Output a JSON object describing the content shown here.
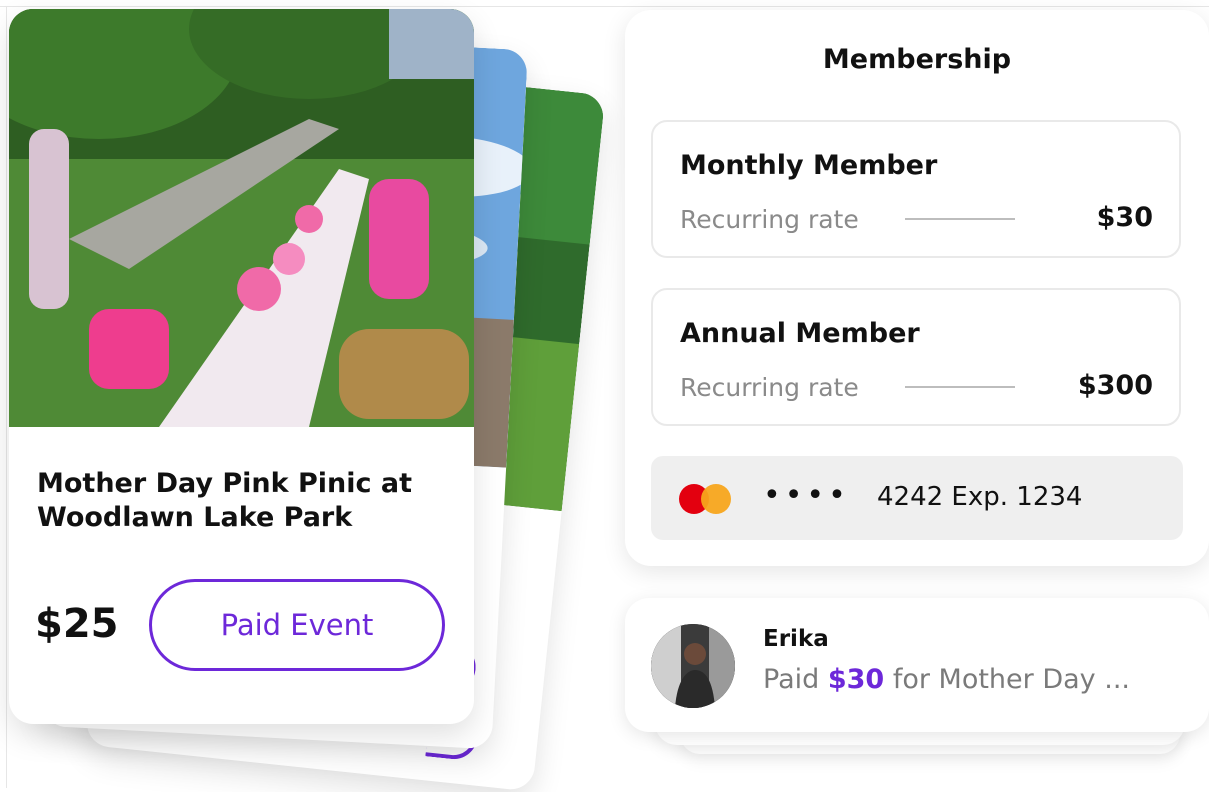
{
  "event_card": {
    "title": "Mother Day Pink Pinic at Woodlawn Lake Park",
    "price": "$25",
    "button_label": "Paid Event"
  },
  "membership": {
    "title": "Membership",
    "plans": [
      {
        "name": "Monthly Member",
        "rate_label": "Recurring rate",
        "price": "$30"
      },
      {
        "name": "Annual Member",
        "rate_label": "Recurring rate",
        "price": "$300"
      }
    ],
    "payment_card": {
      "brand_icon": "mastercard-icon",
      "masked": "••••",
      "details": "4242 Exp. 1234"
    }
  },
  "activity": {
    "name": "Erika",
    "prefix": "Paid",
    "amount": "$30",
    "suffix": "for Mother Day ..."
  },
  "colors": {
    "accent": "#6d28d9",
    "mastercard_red": "#e3000f",
    "mastercard_orange": "#f7a51c"
  }
}
